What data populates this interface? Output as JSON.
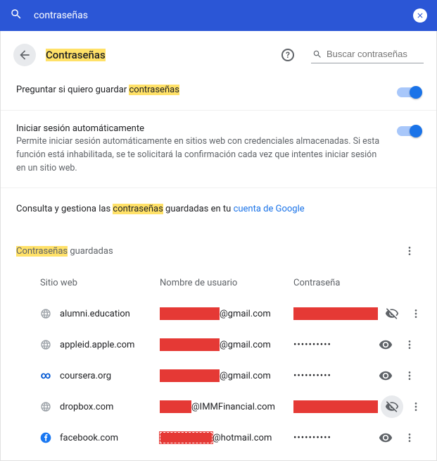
{
  "top_search": {
    "query": "contraseñas"
  },
  "page": {
    "title": "Contraseñas",
    "local_search_placeholder": "Buscar contraseñas",
    "settings": {
      "ask_save": {
        "label_before": "Preguntar si quiero guardar ",
        "label_hl": "contraseñas"
      },
      "auto_signin": {
        "title": "Iniciar sesión automáticamente",
        "desc": "Permite iniciar sesión automáticamente en sitios web con credenciales almacenadas. Si esta función está inhabilitada, se te solicitará la confirmación cada vez que intentes iniciar sesión en un sitio web."
      }
    },
    "manage_note": {
      "before": "Consulta y gestiona las ",
      "hl": "contraseñas",
      "after": " guardadas en tu  ",
      "link": "cuenta de Google"
    },
    "saved_section": {
      "title_hl": "Contraseñas",
      "title_after": " guardadas"
    },
    "columns": {
      "site": "Sitio web",
      "user": "Nombre de usuario",
      "pass": "Contraseña"
    },
    "rows": [
      {
        "site": "alumni.education",
        "user_suffix": "@gmail.com",
        "pass_masked": "",
        "pass_redacted": true,
        "user_redact_w": 85,
        "eye_slash": true,
        "favicon": "generic"
      },
      {
        "site": "appleid.apple.com",
        "user_suffix": "@gmail.com",
        "pass_masked": "••••••••••",
        "pass_redacted": false,
        "user_redact_w": 85,
        "eye_slash": false,
        "favicon": "generic"
      },
      {
        "site": "coursera.org",
        "user_suffix": "@gmail.com",
        "pass_masked": "••••••••••",
        "pass_redacted": false,
        "user_redact_w": 85,
        "eye_slash": false,
        "favicon": "coursera"
      },
      {
        "site": "dropbox.com",
        "user_suffix": "@IMMFinancial.com",
        "pass_masked": "",
        "pass_redacted": true,
        "user_redact_w": 45,
        "eye_slash": true,
        "favicon": "generic",
        "eye_active": true
      },
      {
        "site": "facebook.com",
        "user_suffix": "@hotmail.com",
        "pass_masked": "••••••••••",
        "pass_redacted": false,
        "user_redact_w": 75,
        "user_dashed": true,
        "eye_slash": false,
        "favicon": "facebook"
      }
    ]
  }
}
